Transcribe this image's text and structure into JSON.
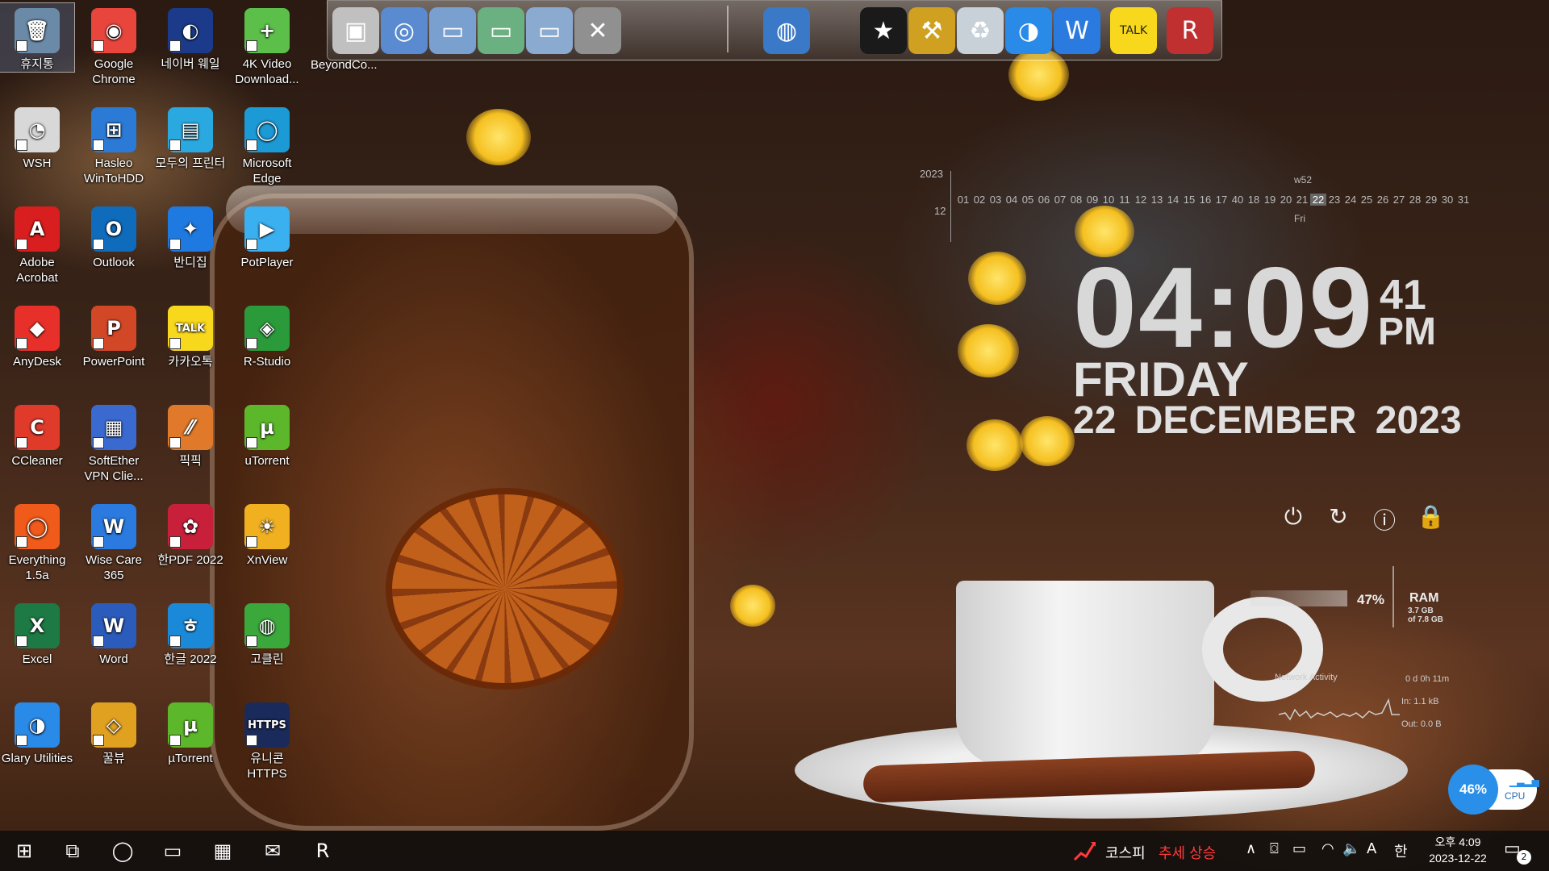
{
  "desktop_icons": [
    {
      "label": "휴지통",
      "color": "#6a8aa8",
      "glyph": "🗑",
      "col": 0,
      "row": 0,
      "selected": true
    },
    {
      "label": "Google Chrome",
      "color": "#e8453c",
      "glyph": "◉",
      "col": 1,
      "row": 0
    },
    {
      "label": "네이버 웨일",
      "color": "#1b3a8a",
      "glyph": "◐",
      "col": 2,
      "row": 0
    },
    {
      "label": "4K Video Download...",
      "color": "#5cbf4a",
      "glyph": "+",
      "col": 3,
      "row": 0
    },
    {
      "label": "WSH",
      "color": "#d8d8d8",
      "glyph": "◔",
      "col": 0,
      "row": 1
    },
    {
      "label": "Hasleo WinToHDD",
      "color": "#2a7ad6",
      "glyph": "⊞",
      "col": 1,
      "row": 1
    },
    {
      "label": "모두의 프린터",
      "color": "#2aa8e0",
      "glyph": "▤",
      "col": 2,
      "row": 1
    },
    {
      "label": "Microsoft Edge",
      "color": "#1c9ad6",
      "glyph": "◯",
      "col": 3,
      "row": 1
    },
    {
      "label": "Adobe Acrobat",
      "color": "#d81e1e",
      "glyph": "A",
      "col": 0,
      "row": 2
    },
    {
      "label": "Outlook",
      "color": "#0f6cbd",
      "glyph": "O",
      "col": 1,
      "row": 2
    },
    {
      "label": "반디집",
      "color": "#1e7ae0",
      "glyph": "✦",
      "col": 2,
      "row": 2
    },
    {
      "label": "PotPlayer",
      "color": "#3ab0f0",
      "glyph": "▶",
      "col": 3,
      "row": 2
    },
    {
      "label": "AnyDesk",
      "color": "#e8302a",
      "glyph": "◆",
      "col": 0,
      "row": 3
    },
    {
      "label": "PowerPoint",
      "color": "#d24726",
      "glyph": "P",
      "col": 1,
      "row": 3
    },
    {
      "label": "카카오톡",
      "color": "#f8d81c",
      "glyph": "TALK",
      "col": 2,
      "row": 3
    },
    {
      "label": "R-Studio",
      "color": "#2a9a3a",
      "glyph": "◈",
      "col": 3,
      "row": 3
    },
    {
      "label": "CCleaner",
      "color": "#e03a2a",
      "glyph": "C",
      "col": 0,
      "row": 4
    },
    {
      "label": "SoftEther VPN Clie...",
      "color": "#3a6ad0",
      "glyph": "▦",
      "col": 1,
      "row": 4
    },
    {
      "label": "픽픽",
      "color": "#e07a2a",
      "glyph": "⁄⁄",
      "col": 2,
      "row": 4
    },
    {
      "label": "uTorrent",
      "color": "#5cb82a",
      "glyph": "µ",
      "col": 3,
      "row": 4
    },
    {
      "label": "Everything 1.5a",
      "color": "#f05a1a",
      "glyph": "◯",
      "col": 0,
      "row": 5
    },
    {
      "label": "Wise Care 365",
      "color": "#2a7ae0",
      "glyph": "W",
      "col": 1,
      "row": 5
    },
    {
      "label": "한PDF 2022",
      "color": "#c8203a",
      "glyph": "✿",
      "col": 2,
      "row": 5
    },
    {
      "label": "XnView",
      "color": "#f0b020",
      "glyph": "☀",
      "col": 3,
      "row": 5
    },
    {
      "label": "Excel",
      "color": "#1d7a44",
      "glyph": "X",
      "col": 0,
      "row": 6
    },
    {
      "label": "Word",
      "color": "#2b5cbc",
      "glyph": "W",
      "col": 1,
      "row": 6
    },
    {
      "label": "한글 2022",
      "color": "#1a8ad8",
      "glyph": "ㅎ",
      "col": 2,
      "row": 6
    },
    {
      "label": "고클린",
      "color": "#3aa83a",
      "glyph": "◍",
      "col": 3,
      "row": 6
    },
    {
      "label": "Glary Utilities",
      "color": "#2a8ae8",
      "glyph": "◑",
      "col": 0,
      "row": 7
    },
    {
      "label": "꿀뷰",
      "color": "#e0a020",
      "glyph": "◇",
      "col": 1,
      "row": 7
    },
    {
      "label": "µTorrent",
      "color": "#5cb82a",
      "glyph": "µ",
      "col": 2,
      "row": 7
    },
    {
      "label": "유니콘 HTTPS",
      "color": "#1a2a5a",
      "glyph": "HTTPS",
      "col": 3,
      "row": 7
    }
  ],
  "dock": {
    "label": "BeyondCo...",
    "items": [
      {
        "name": "beyond-compare-icon",
        "glyph": "▣",
        "color": "#c0c0c0"
      },
      {
        "name": "network-globe-icon",
        "glyph": "◎",
        "color": "#5a8ad0"
      },
      {
        "name": "folder-icon",
        "glyph": "▭",
        "color": "#7aa0d0"
      },
      {
        "name": "folder-green-icon",
        "glyph": "▭",
        "color": "#6ab080"
      },
      {
        "name": "folder-open-icon",
        "glyph": "▭",
        "color": "#8aaad0"
      },
      {
        "name": "utilities-tools-icon",
        "glyph": "✕",
        "color": "#909090"
      },
      {
        "name": "globe-icon",
        "glyph": "◍",
        "color": "#3a78c8"
      },
      {
        "name": "tshirt-icon",
        "glyph": "★",
        "color": "#1a1a1a"
      },
      {
        "name": "hammer-icon",
        "glyph": "⚒",
        "color": "#d0a020"
      },
      {
        "name": "recycle-bin-icon",
        "glyph": "♻",
        "color": "#c8d0d8"
      },
      {
        "name": "glary-icon",
        "glyph": "◑",
        "color": "#2a8ae8"
      },
      {
        "name": "wise-care-icon",
        "glyph": "W",
        "color": "#2a7ae0"
      },
      {
        "name": "kakaotalk-icon",
        "glyph": "TALK",
        "color": "#f8d81c"
      },
      {
        "name": "rstudio-icon",
        "glyph": "R",
        "color": "#c03030"
      }
    ]
  },
  "calendar": {
    "year": "2023",
    "month": "12",
    "week": "w52",
    "days": [
      "01",
      "02",
      "03",
      "04",
      "05",
      "06",
      "07",
      "08",
      "09",
      "10",
      "11",
      "12",
      "13",
      "14",
      "15",
      "16",
      "17",
      "40",
      "18",
      "19",
      "20",
      "21",
      "22",
      "23",
      "24",
      "25",
      "26",
      "27",
      "28",
      "29",
      "30",
      "31"
    ],
    "today": "22",
    "today_dow": "Fri"
  },
  "clock": {
    "time": "04:09",
    "seconds": "41",
    "ampm": "PM",
    "day": "FRIDAY",
    "date": "22 DECEMBER 2023"
  },
  "power_buttons": [
    {
      "name": "power-icon",
      "glyph": "⏻"
    },
    {
      "name": "restart-icon",
      "glyph": "↻"
    },
    {
      "name": "info-icon",
      "glyph": "ⓘ"
    },
    {
      "name": "lock-icon",
      "glyph": "🔒"
    }
  ],
  "system": {
    "ram_percent": "47%",
    "ram_label": "RAM",
    "ram_used": "3.7 GB",
    "ram_total": "of 7.8 GB",
    "network_title": "Network Activity",
    "uptime": "0 d 0h 11m",
    "net_in": "In: 1.1 kB",
    "net_out": "Out: 0.0 B",
    "cpu_percent": "46%",
    "cpu_label": "CPU"
  },
  "taskbar": {
    "items": [
      {
        "name": "start-button",
        "glyph": "⊞"
      },
      {
        "name": "task-view-icon",
        "glyph": "⧉"
      },
      {
        "name": "edge-taskbar-icon",
        "glyph": "◯"
      },
      {
        "name": "file-explorer-icon",
        "glyph": "▭"
      },
      {
        "name": "store-icon",
        "glyph": "▦"
      },
      {
        "name": "mail-icon",
        "glyph": "✉"
      },
      {
        "name": "rstudio-taskbar-icon",
        "glyph": "R"
      }
    ],
    "kospi_label": "코스피",
    "kospi_trend": "추세 상승",
    "tray": [
      {
        "name": "show-hidden-icons",
        "glyph": "∧"
      },
      {
        "name": "camera-icon",
        "glyph": "⌼"
      },
      {
        "name": "battery-icon",
        "glyph": "▭"
      },
      {
        "name": "wifi-icon",
        "glyph": "◠"
      },
      {
        "name": "volume-icon",
        "glyph": "🔈"
      },
      {
        "name": "font-icon",
        "glyph": "A"
      },
      {
        "name": "ime-icon",
        "glyph": "한"
      }
    ],
    "time": "오후 4:09",
    "date": "2023-12-22",
    "notification_count": "2"
  },
  "colors": {
    "kospi_trend": "#ff3a3a",
    "cpu_accent": "#2a8fe8"
  }
}
